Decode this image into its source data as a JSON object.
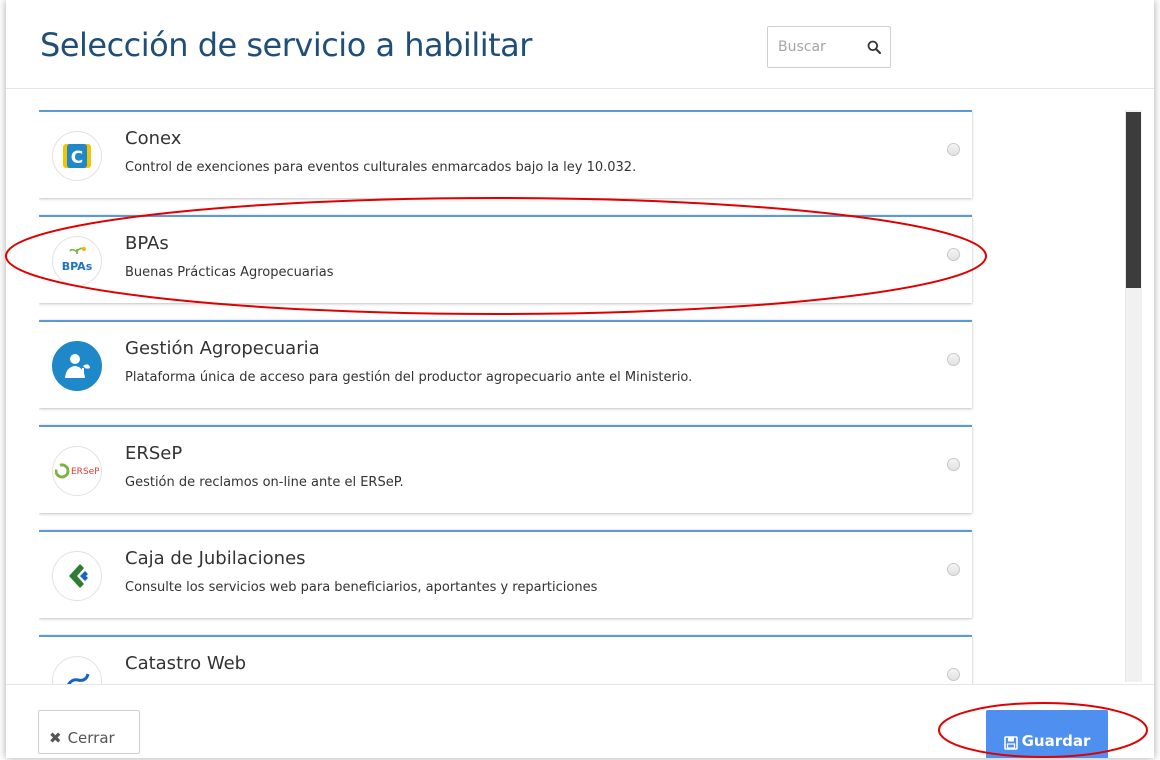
{
  "header": {
    "title": "Selección de servicio a habilitar",
    "search_placeholder": "Buscar"
  },
  "services": [
    {
      "name": "Conex",
      "description": "Control de exenciones para eventos culturales enmarcados bajo la ley 10.032.",
      "icon": "conex-logo-icon"
    },
    {
      "name": "BPAs",
      "description": "Buenas Prácticas Agropecuarias",
      "icon": "bpas-logo-icon",
      "logo_text": "BPAs"
    },
    {
      "name": "Gestión Agropecuaria",
      "description": "Plataforma única de acceso para gestión del productor agropecuario ante el Ministerio.",
      "icon": "farmer-logo-icon"
    },
    {
      "name": "ERSeP",
      "description": "Gestión de reclamos on-line ante el ERSeP.",
      "icon": "ersep-logo-icon",
      "logo_text": "ERSeP"
    },
    {
      "name": "Caja de Jubilaciones",
      "description": "Consulte los servicios web para beneficiarios, aportantes y reparticiones",
      "icon": "caja-logo-icon"
    },
    {
      "name": "Catastro Web",
      "description": "",
      "icon": "catastro-logo-icon"
    }
  ],
  "footer": {
    "close_label": "Cerrar",
    "save_label": "Guardar"
  },
  "colors": {
    "title": "#1f4e79",
    "card_accent": "#5b9bd5",
    "save_button": "#4e8ff0",
    "annotation": "#e00000"
  }
}
